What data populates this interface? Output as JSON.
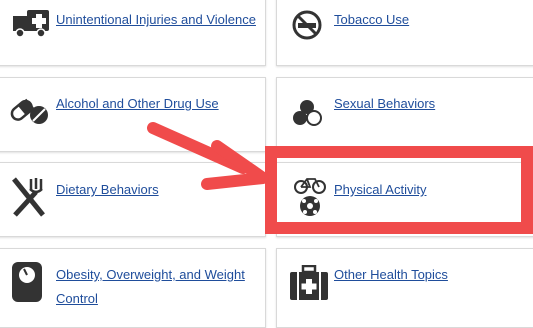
{
  "topics": [
    {
      "label": "Unintentional Injuries and Violence",
      "icon": "ambulance-icon"
    },
    {
      "label": "Tobacco Use",
      "icon": "no-smoking-icon"
    },
    {
      "label": "Alcohol and Other Drug Use",
      "icon": "pills-icon"
    },
    {
      "label": "Sexual Behaviors",
      "icon": "sexual-behaviors-icon"
    },
    {
      "label": "Dietary Behaviors",
      "icon": "fork-knife-icon"
    },
    {
      "label": "Physical Activity",
      "icon": "bicycle-ball-icon"
    },
    {
      "label": "Obesity, Overweight, and Weight Control",
      "icon": "scale-icon"
    },
    {
      "label": "Other Health Topics",
      "icon": "first-aid-kit-icon"
    }
  ],
  "annotation": {
    "highlight_color": "#f04b4b",
    "highlighted_topic": "Physical Activity"
  },
  "colors": {
    "link": "#1f4d9b",
    "icon": "#333333"
  }
}
